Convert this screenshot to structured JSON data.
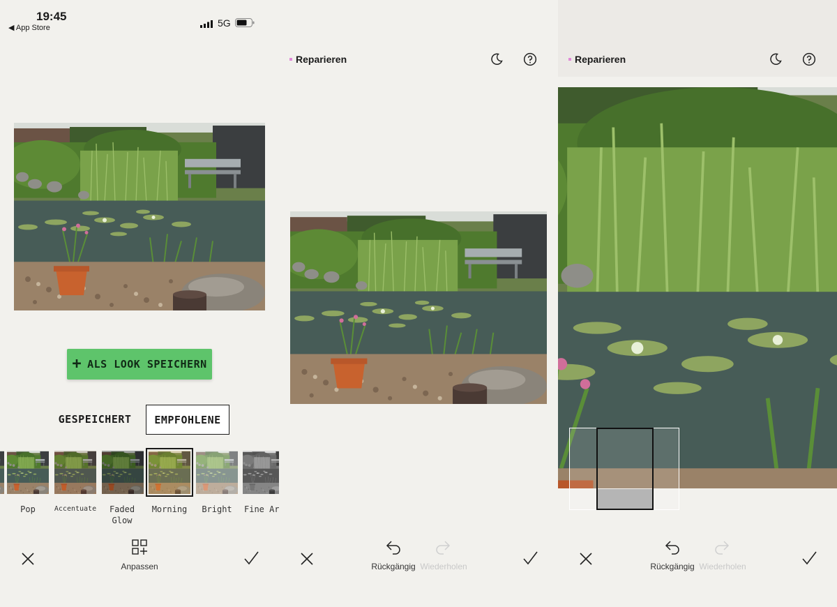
{
  "status": {
    "time": "19:45",
    "back_app": "◀ App Store",
    "network": "5G"
  },
  "panel1": {
    "save_look": {
      "plus": "+",
      "label": "ALS LOOK SPEICHERN"
    },
    "tabs": [
      {
        "label": "GESPEICHERT",
        "selected": false
      },
      {
        "label": "EMPFOHLENE",
        "selected": true
      }
    ],
    "filters": [
      {
        "name": "Pop",
        "tone": "normal"
      },
      {
        "name": "Accentuate",
        "tone": "accent"
      },
      {
        "name": "Faded Glow",
        "tone": "dark"
      },
      {
        "name": "Morning",
        "tone": "warm",
        "selected": true
      },
      {
        "name": "Bright",
        "tone": "bright"
      },
      {
        "name": "Fine Ar",
        "tone": "mono"
      }
    ],
    "toolbar": {
      "adjust_label": "Anpassen"
    }
  },
  "panel2": {
    "title": "Reparieren",
    "toolbar": {
      "undo_label": "Rückgängig",
      "redo_label": "Wiederholen"
    }
  },
  "panel3": {
    "title": "Reparieren",
    "toolbar": {
      "undo_label": "Rückgängig",
      "redo_label": "Wiederholen"
    }
  },
  "icons": [
    "close-icon",
    "adjust-grid-icon",
    "checkmark-icon",
    "moon-icon",
    "help-icon",
    "undo-icon",
    "redo-icon"
  ],
  "colors": {
    "accent_green": "#5ec46b",
    "background": "#f2f1ed",
    "title_dot": "#e08ad8"
  }
}
